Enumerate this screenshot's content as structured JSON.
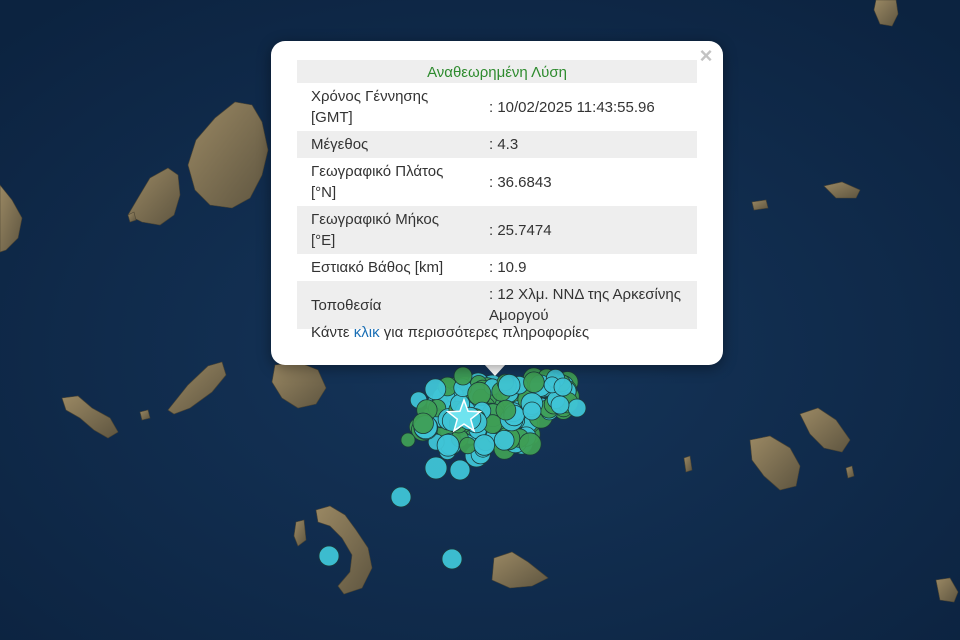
{
  "popup": {
    "title": "Αναθεωρημένη Λύση",
    "close_symbol": "×",
    "rows": [
      {
        "label": "Χρόνος Γέννησης [GMT]",
        "value": ": 10/02/2025 11:43:55.96"
      },
      {
        "label": "Μέγεθος",
        "value": ": 4.3"
      },
      {
        "label": "Γεωγραφικό Πλάτος [°N]",
        "value": ": 36.6843"
      },
      {
        "label": "Γεωγραφικό Μήκος [°E]",
        "value": ": 25.7474"
      },
      {
        "label": "Εστιακό Βάθος [km]",
        "value": ": 10.9"
      },
      {
        "label": "Τοποθεσία",
        "value": ": 12 Χλμ. ΝΝΔ της Αρκεσίνης Αμοργού"
      }
    ],
    "more_prefix": "Κάντε ",
    "more_link": "κλικ",
    "more_suffix": " για περισσότερες πληροφορίες"
  },
  "colors": {
    "sea": "#0f2a47",
    "land": "#7a6b4e",
    "cyan_marker": "#3fc4d6",
    "green_marker": "#3e9e55",
    "star_marker": "#6fe3ef",
    "title_green": "#2e8b2e",
    "link_blue": "#1a6fb5"
  },
  "icons": {
    "epicenter": "star-icon",
    "close": "close-icon"
  }
}
